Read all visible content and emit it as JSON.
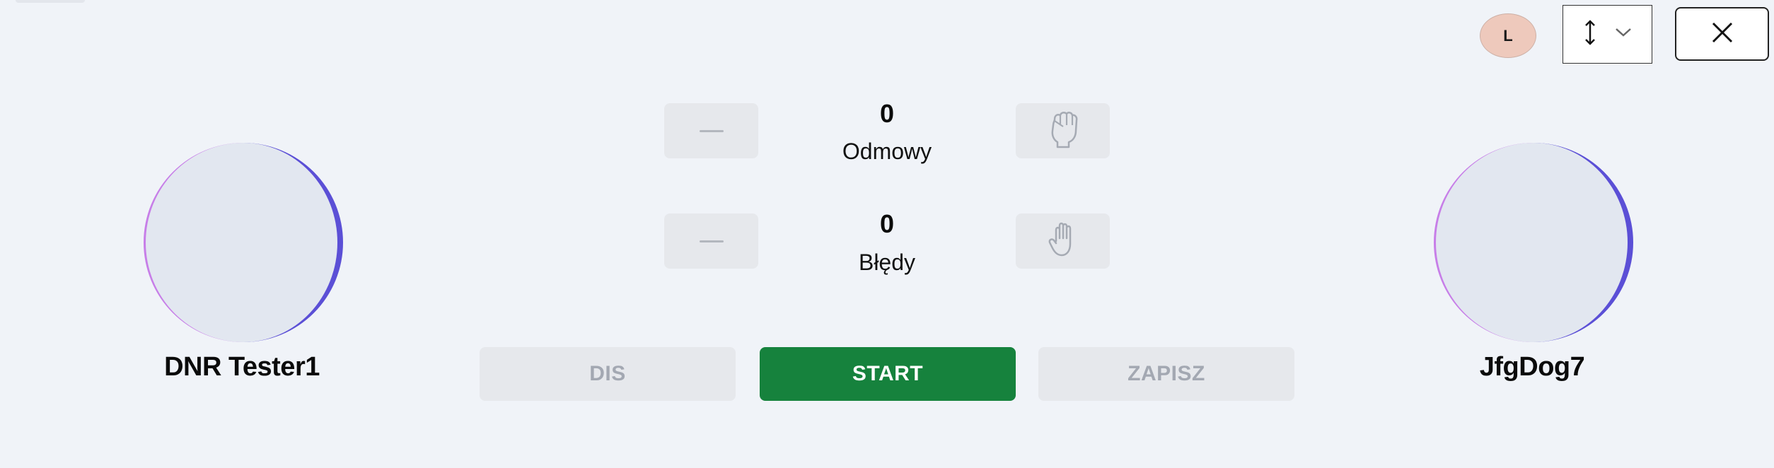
{
  "top_right": {
    "avatar_initial": "L",
    "sort_icon": "vertical-arrows-icon",
    "dropdown_icon": "chevron-down-icon",
    "close_icon": "close-icon"
  },
  "players": {
    "left": {
      "name": "DNR Tester1"
    },
    "right": {
      "name": "JfgDog7"
    }
  },
  "stats": {
    "refusals": {
      "value": "0",
      "label": "Odmowy",
      "icon": "fist-icon"
    },
    "faults": {
      "value": "0",
      "label": "Błędy",
      "icon": "open-hand-icon"
    }
  },
  "actions": {
    "dis_label": "DIS",
    "start_label": "START",
    "save_label": "ZAPISZ"
  },
  "colors": {
    "background": "#f0f3f8",
    "start_button": "#16823d",
    "disabled_button": "#e6e8ec",
    "disabled_text": "#a3a8b2",
    "avatar_badge": "#eec9bc",
    "circle_fill": "#e2e7f0",
    "circle_accent_left": "#c77ee8",
    "circle_accent_right": "#5b4fd6"
  }
}
